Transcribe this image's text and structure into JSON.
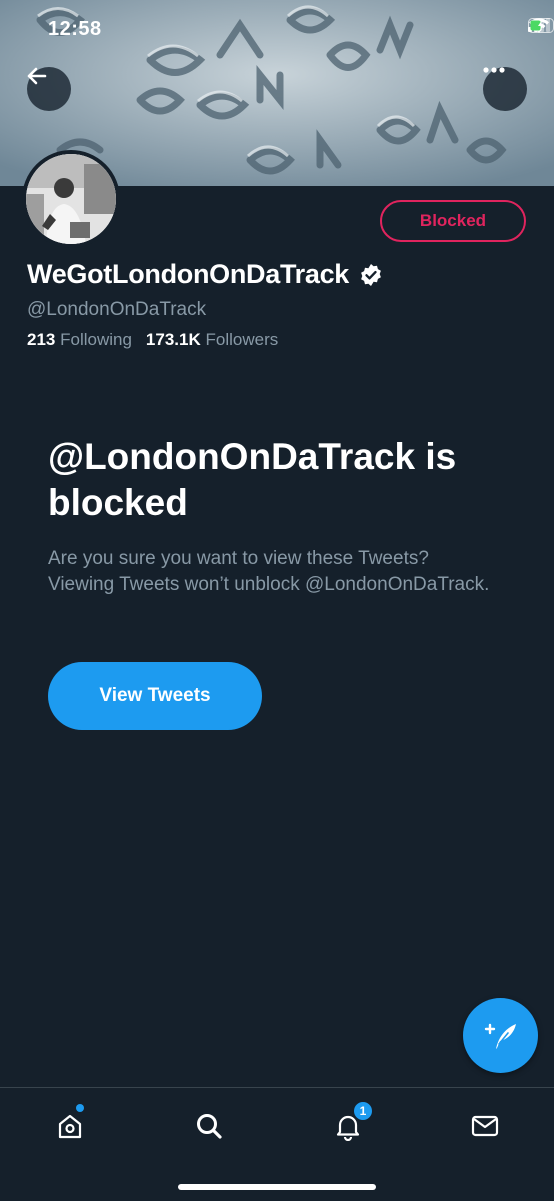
{
  "status_bar": {
    "time": "12:58"
  },
  "profile": {
    "blocked_label": "Blocked",
    "display_name": "WeGotLondonOnDaTrack",
    "handle": "@LondonOnDaTrack",
    "following_count": "213",
    "following_label": "Following",
    "followers_count": "173.1K",
    "followers_label": "Followers",
    "verified": true
  },
  "blocked_notice": {
    "title": "@LondonOnDaTrack is blocked",
    "description": "Are you sure you want to view these Tweets? Viewing Tweets won’t unblock @LondonOnDaTrack.",
    "view_button_label": "View Tweets"
  },
  "tab_bar": {
    "items": [
      {
        "name": "home",
        "icon": "home-icon",
        "has_dot": true
      },
      {
        "name": "search",
        "icon": "search-icon"
      },
      {
        "name": "notifications",
        "icon": "bell-icon",
        "badge": "1"
      },
      {
        "name": "messages",
        "icon": "envelope-icon"
      }
    ]
  },
  "colors": {
    "background": "#15202b",
    "accent": "#1d9bf0",
    "blocked_red": "#e0245e",
    "secondary_text": "#8899a6"
  }
}
